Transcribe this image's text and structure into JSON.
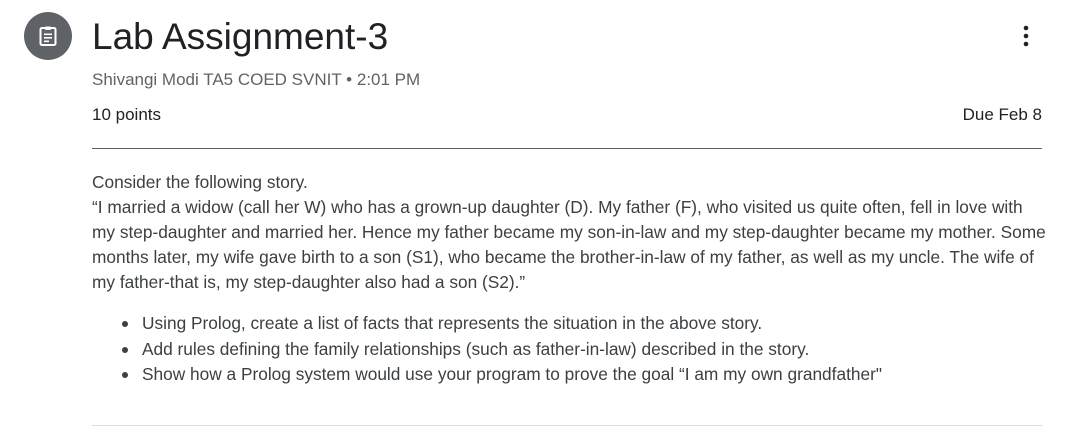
{
  "header": {
    "icon": "assignment-icon",
    "title": "Lab Assignment-3",
    "more_icon": "more-vert-icon",
    "author": "Shivangi Modi TA5 COED SVNIT",
    "separator": "•",
    "time": "2:01 PM"
  },
  "details": {
    "points": "10 points",
    "due": "Due Feb 8"
  },
  "instructions": {
    "intro": "Consider the following story.",
    "story": "“I married a widow (call her W) who has a grown-up daughter (D). My father (F), who visited us quite often, fell in love with my step-daughter and married her. Hence my father became my son-in-law and my step-daughter became my mother. Some months later, my wife gave birth to a son (S1), who became the brother-in-law of my father, as well as my uncle. The wife of my father-that is, my step-daughter also had a son (S2).”",
    "tasks": [
      "Using Prolog, create a list of facts that represents the situation in the above story.",
      "Add rules defining the family relationships (such as father-in-law) described in the story.",
      "Show how a Prolog system would use your program to prove the goal “I am my own grandfather\""
    ]
  }
}
